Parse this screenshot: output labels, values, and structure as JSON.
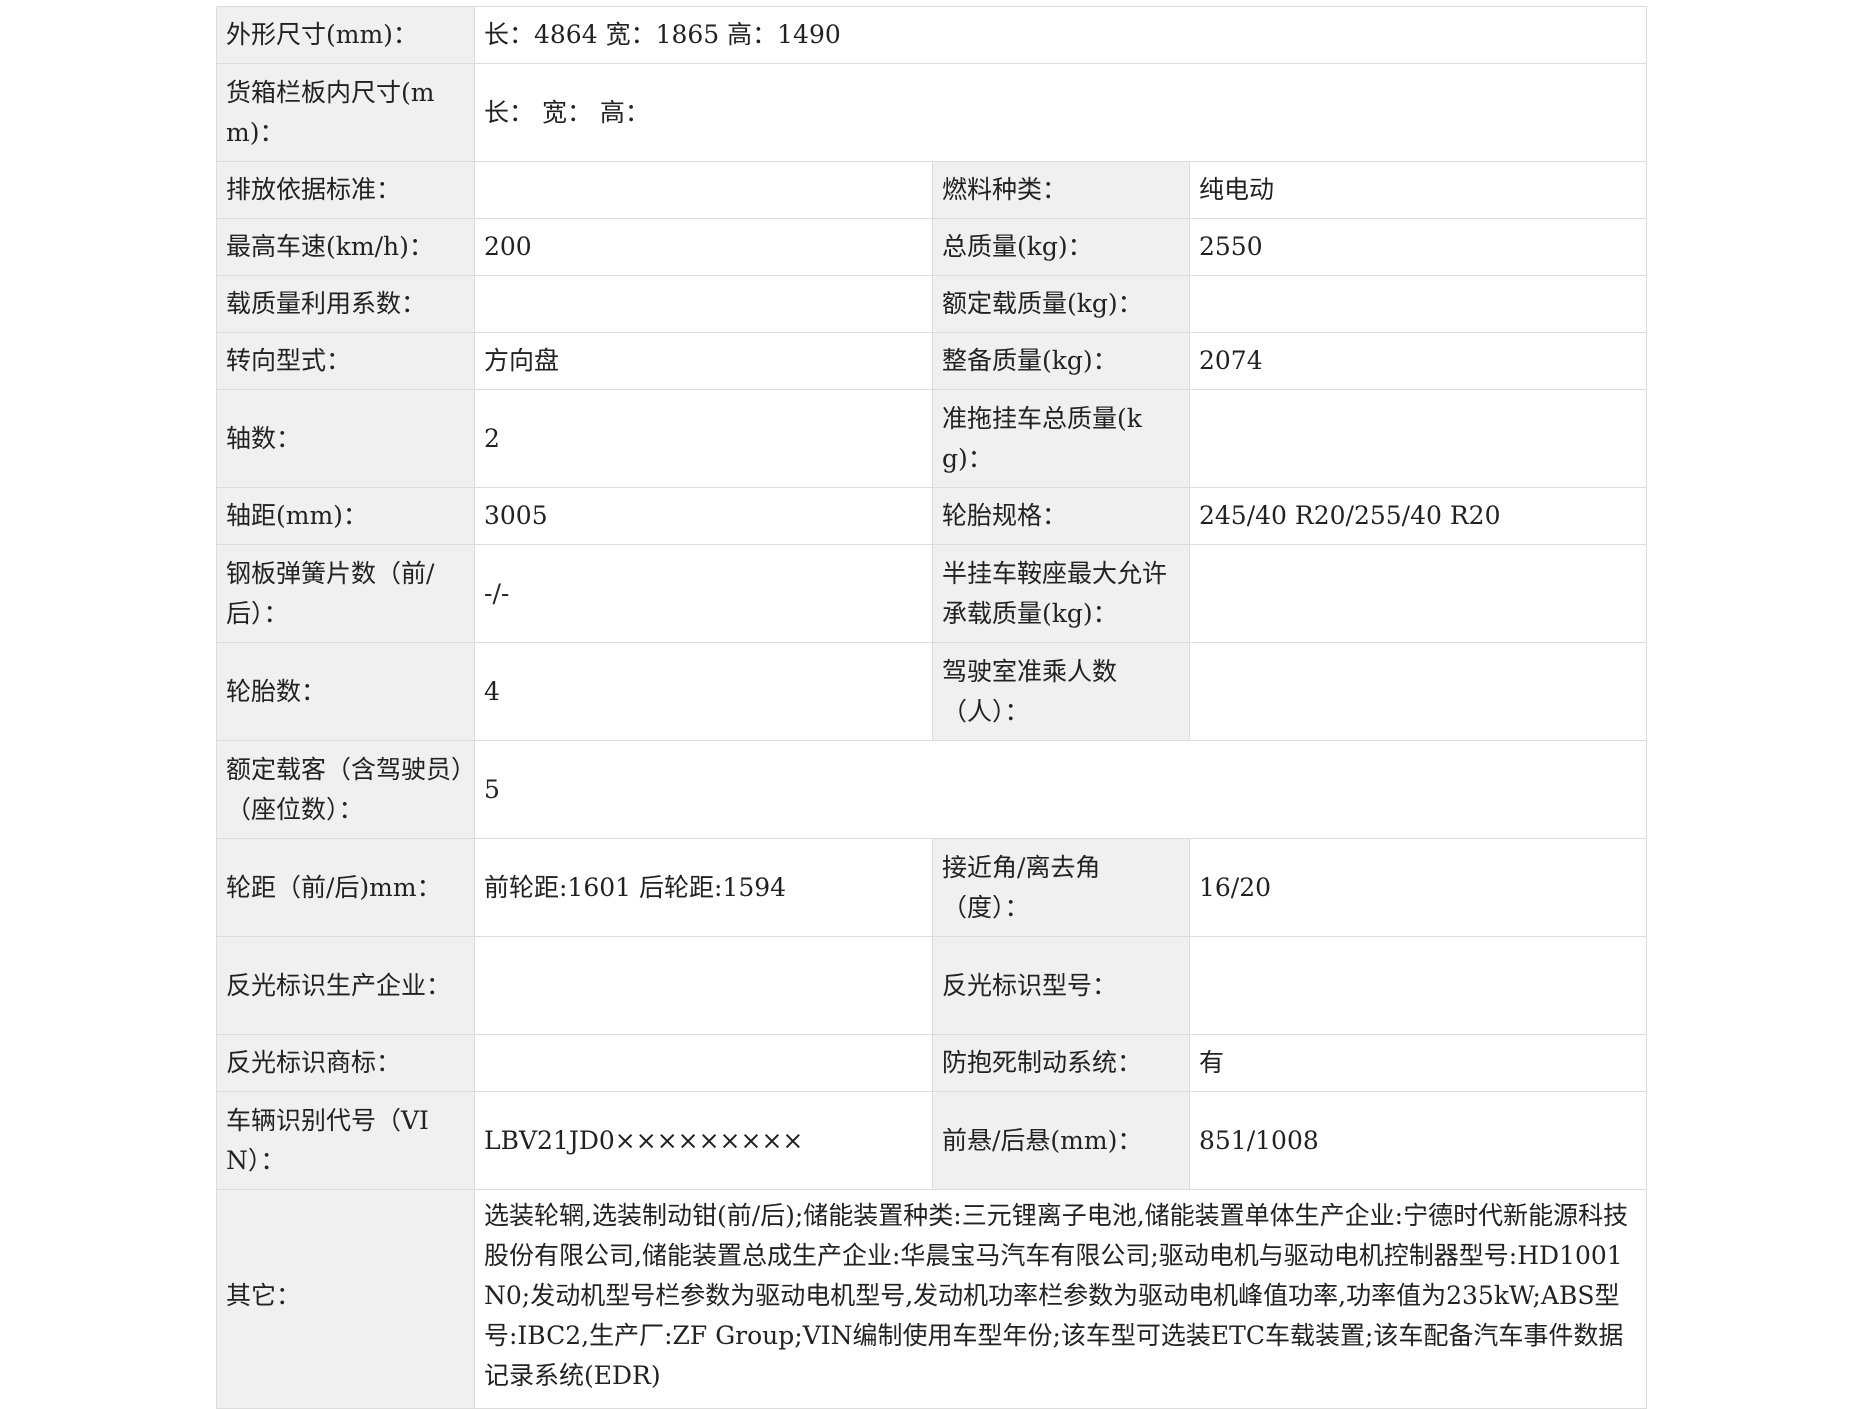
{
  "rows": [
    {
      "label": "外形尺寸(mm)：",
      "value": "长：4864 宽：1865 高：1490",
      "span": true
    },
    {
      "label": "货箱栏板内尺寸(mm)：",
      "value": "长： 宽： 高：",
      "span": true
    },
    {
      "label1": "排放依据标准：",
      "value1": "",
      "label2": "燃料种类：",
      "value2": "纯电动"
    },
    {
      "label1": "最高车速(km/h)：",
      "value1": "200",
      "label2": "总质量(kg)：",
      "value2": "2550"
    },
    {
      "label1": "载质量利用系数：",
      "value1": "",
      "label2": "额定载质量(kg)：",
      "value2": ""
    },
    {
      "label1": "转向型式：",
      "value1": "方向盘",
      "label2": "整备质量(kg)：",
      "value2": "2074"
    },
    {
      "label1": "轴数：",
      "value1": "2",
      "label2": "准拖挂车总质量(kg)：",
      "value2": ""
    },
    {
      "label1": "轴距(mm)：",
      "value1": "3005",
      "label2": "轮胎规格：",
      "value2": "245/40 R20/255/40 R20"
    },
    {
      "label1": "钢板弹簧片数（前/后）：",
      "value1": "-/-",
      "label2": "半挂车鞍座最大允许承载质量(kg)：",
      "value2": ""
    },
    {
      "label1": "轮胎数：",
      "value1": "4",
      "label2": "驾驶室准乘人数（人）：",
      "value2": ""
    },
    {
      "label": "额定载客（含驾驶员）（座位数）：",
      "value": "5",
      "span": true
    },
    {
      "label1": "轮距（前/后)mm：",
      "value1": "前轮距:1601 后轮距:1594",
      "label2": "接近角/离去角（度）：",
      "value2": "16/20"
    },
    {
      "label1": "反光标识生产企业：",
      "value1": "",
      "label2": "反光标识型号：",
      "value2": ""
    },
    {
      "label1": "反光标识商标：",
      "value1": "",
      "label2": "防抱死制动系统：",
      "value2": "有"
    },
    {
      "label1": "车辆识别代号（VIN）：",
      "value1": "LBV21JD0×××××××××",
      "label2": "前悬/后悬(mm)：",
      "value2": "851/1008"
    },
    {
      "label": "其它：",
      "value": "选装轮辋,选装制动钳(前/后);储能装置种类:三元锂离子电池,储能装置单体生产企业:宁德时代新能源科技股份有限公司,储能装置总成生产企业:华晨宝马汽车有限公司;驱动电机与驱动电机控制器型号:HD1001N0;发动机型号栏参数为驱动电机型号,发动机功率栏参数为驱动电机峰值功率,功率值为235kW;ABS型号:IBC2,生产厂:ZF Group;VIN编制使用车型年份;该车型可选装ETC车载装置;该车配备汽车事件数据记录系统(EDR)",
      "span": true
    }
  ]
}
